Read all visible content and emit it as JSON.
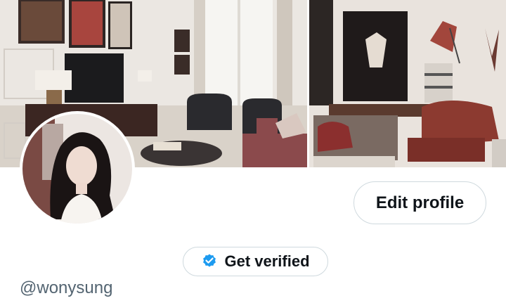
{
  "profile": {
    "handle": "@wonysung",
    "edit_label": "Edit profile",
    "verify_label": "Get verified"
  },
  "icons": {
    "verified": "verified-badge-icon"
  },
  "colors": {
    "verified_badge": "#1d9bf0",
    "button_border": "#cfd9de",
    "text_primary": "#0f1419",
    "text_secondary": "#536471"
  }
}
